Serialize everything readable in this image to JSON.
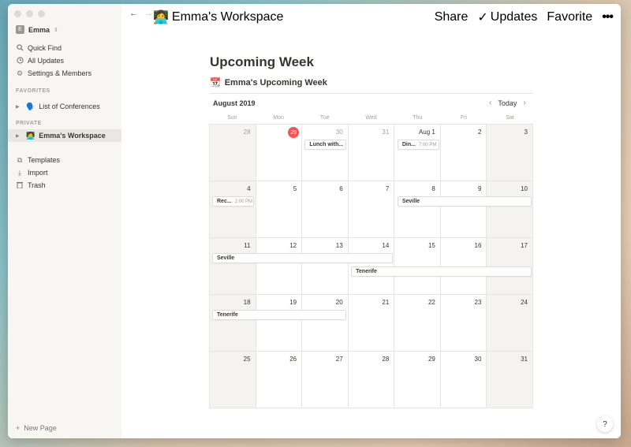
{
  "user": {
    "initial": "E",
    "name": "Emma",
    "chevron": "⌃"
  },
  "sidebar": {
    "items": [
      {
        "label": "Quick Find",
        "icon": "search-icon"
      },
      {
        "label": "All Updates",
        "icon": "clock-icon"
      },
      {
        "label": "Settings & Members",
        "icon": "gear-icon"
      }
    ],
    "favorites_heading": "FAVORITES",
    "favorites": [
      {
        "label": "List of Conferences",
        "emoji": "🗣️"
      }
    ],
    "private_heading": "PRIVATE",
    "private": [
      {
        "label": "Emma's Workspace",
        "emoji": "👩‍💻"
      }
    ],
    "tools": [
      {
        "label": "Templates",
        "icon": "templates-icon"
      },
      {
        "label": "Import",
        "icon": "import-icon"
      },
      {
        "label": "Trash",
        "icon": "trash-icon"
      }
    ],
    "new_page": "New Page"
  },
  "topbar": {
    "breadcrumb": "Emma's Workspace",
    "breadcrumb_emoji": "👩‍💻",
    "share": "Share",
    "updates": "Updates",
    "favorite": "Favorite",
    "more": "•••"
  },
  "page": {
    "title": "Upcoming Week",
    "db_emoji": "📆",
    "db_title": "Emma's Upcoming Week"
  },
  "calendar": {
    "month": "August 2019",
    "today_label": "Today",
    "weekdays": [
      "Sun",
      "Mon",
      "Tue",
      "Wed",
      "Thu",
      "Fri",
      "Sat"
    ],
    "days": [
      "28",
      "29",
      "30",
      "31",
      "Aug 1",
      "2",
      "3",
      "4",
      "5",
      "6",
      "7",
      "8",
      "9",
      "10",
      "11",
      "12",
      "13",
      "14",
      "15",
      "16",
      "17",
      "18",
      "19",
      "20",
      "21",
      "22",
      "23",
      "24",
      "25",
      "26",
      "27",
      "28",
      "29",
      "30",
      "31"
    ],
    "today_index": 1,
    "dim_indices": [
      0,
      2,
      3
    ],
    "events": [
      {
        "label": "Lunch with...",
        "time": "",
        "row": 0,
        "col": 2,
        "span": 1
      },
      {
        "label": "Din...",
        "time": "7:00 PM",
        "row": 0,
        "col": 4,
        "span": 1
      },
      {
        "label": "Rec...",
        "time": "2:00 PM",
        "row": 1,
        "col": 0,
        "span": 1
      },
      {
        "label": "Seville",
        "time": "",
        "row": 1,
        "col": 4,
        "span": 3
      },
      {
        "label": "Seville",
        "time": "",
        "row": 2,
        "col": 0,
        "span": 4
      },
      {
        "label": "Tenerife",
        "time": "",
        "row": 2,
        "col": 3,
        "span": 4,
        "lane": 1
      },
      {
        "label": "Tenerife",
        "time": "",
        "row": 3,
        "col": 0,
        "span": 3
      }
    ]
  },
  "help": "?"
}
